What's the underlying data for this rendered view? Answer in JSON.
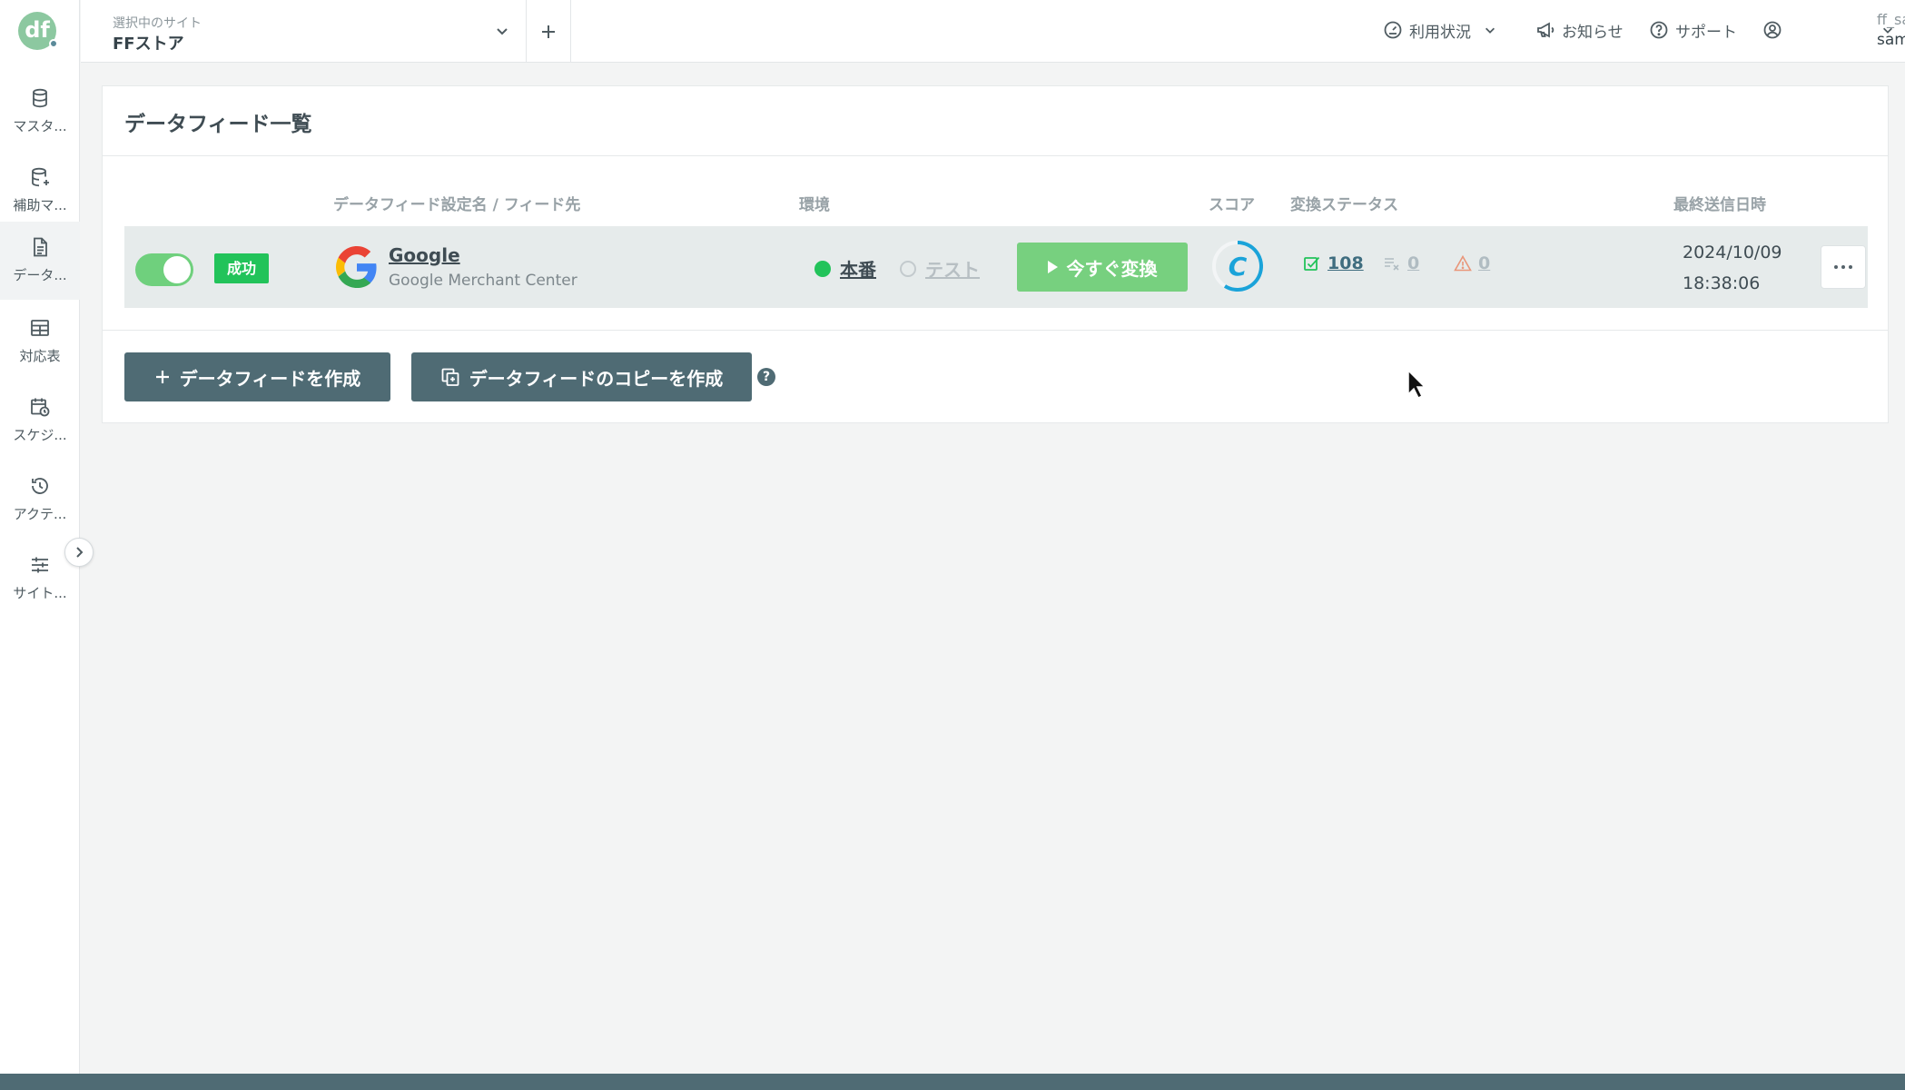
{
  "sidebar": {
    "logo_text": "df",
    "items": [
      {
        "label": "マスタ..."
      },
      {
        "label": "補助マ..."
      },
      {
        "label": "データ..."
      },
      {
        "label": "対応表"
      },
      {
        "label": "スケジ..."
      },
      {
        "label": "アクテ..."
      },
      {
        "label": "サイト..."
      }
    ]
  },
  "header": {
    "site_caption": "選択中のサイト",
    "site_name": "FFストア",
    "usage_label": "利用状況",
    "news_label": "お知らせ",
    "support_label": "サポート",
    "user_sub": "ff_sample",
    "user_name": "sample_g"
  },
  "main": {
    "title": "データフィード一覧",
    "columns": {
      "name": "データフィード設定名 / フィード先",
      "env": "環境",
      "score": "スコア",
      "status": "変換ステータス",
      "last_sent": "最終送信日時"
    },
    "feed": {
      "status_badge": "成功",
      "name": "Google",
      "destination": "Google Merchant Center",
      "env_prod": "本番",
      "env_test": "テスト",
      "run_label": "今すぐ変換",
      "score_letter": "C",
      "ok_count": "108",
      "skip_count": "0",
      "warn_count": "0",
      "last_sent_date": "2024/10/09",
      "last_sent_time": "18:38:06"
    },
    "create_label": "データフィードを作成",
    "copy_label": "データフィードのコピーを作成",
    "help_glyph": "?"
  },
  "colors": {
    "accent_green": "#22c35a",
    "button_green": "#77d07f",
    "button_dark": "#4f6b74",
    "score_blue": "#1aa3d9"
  }
}
